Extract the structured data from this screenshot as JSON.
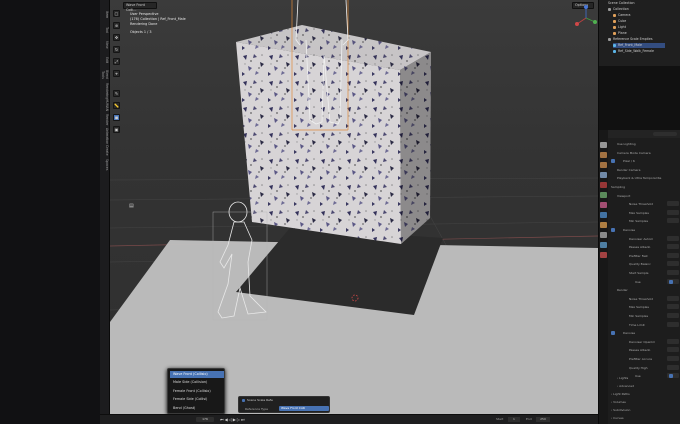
{
  "viewport": {
    "editor_label": "Wave Front Colli...",
    "overlay": {
      "line1": "User Perspective",
      "line2": "(176) Collection | Ref_Front_Male",
      "line3": "Rendering Done",
      "line4": "Objects   1 / 3"
    },
    "options_label": "Options"
  },
  "left_tabs": [
    "Item",
    "Tool",
    "View",
    "Edit",
    "Blend Tools",
    "Rendering",
    "HUMAN",
    "Render",
    "Animation",
    "Create",
    "Spaces"
  ],
  "tools": [
    "select-icon",
    "cursor-icon",
    "move-icon",
    "rotate-icon",
    "scale-icon",
    "transform-icon",
    "annotate-icon",
    "measure-icon",
    "add-cube-icon",
    "camera-icon"
  ],
  "outliner": {
    "title": "Scene Collection",
    "items": [
      {
        "label": "Collection",
        "color": "#9a9a9a",
        "indent": 1
      },
      {
        "label": "Camera",
        "color": "#e0a05a",
        "indent": 2
      },
      {
        "label": "Cube",
        "color": "#e0a05a",
        "indent": 2
      },
      {
        "label": "Light",
        "color": "#e0a05a",
        "indent": 2
      },
      {
        "label": "Plane",
        "color": "#e0a05a",
        "indent": 2
      },
      {
        "label": "Reference Scale Empties",
        "color": "#9a9a9a",
        "indent": 1
      },
      {
        "label": "Ref_Front_Male",
        "color": "#5bb5e8",
        "indent": 2,
        "selected": true
      },
      {
        "label": "Ref_Side_Walk_Female",
        "color": "#5bb5e8",
        "indent": 2
      }
    ]
  },
  "properties": {
    "rows": [
      {
        "label": "Use Lighting",
        "indent": 1
      },
      {
        "label": "Camera Mode   Camera",
        "indent": 1
      },
      {
        "label": "Pixel / 6",
        "indent": 2
      },
      {
        "label": "Render Camera",
        "indent": 1
      },
      {
        "label": "Playback & Ultra Temporal Re",
        "indent": 1
      },
      {
        "label": "Sampling",
        "indent": 0
      },
      {
        "label": "Viewport",
        "indent": 1
      },
      {
        "label": "Noise Threshold",
        "indent": 3
      },
      {
        "label": "Max Samples",
        "indent": 3
      },
      {
        "label": "Min Samples",
        "indent": 3
      },
      {
        "label": "Denoise",
        "indent": 2
      },
      {
        "label": "Denoiser   Autom",
        "indent": 3
      },
      {
        "label": "Passes   Albedo",
        "indent": 3
      },
      {
        "label": "Prefilter   Fast",
        "indent": 3
      },
      {
        "label": "Quality   Balanc",
        "indent": 3
      },
      {
        "label": "Start Sample",
        "indent": 3
      },
      {
        "label": "Use",
        "indent": 4
      },
      {
        "label": "Render",
        "indent": 1
      },
      {
        "label": "Noise Threshold",
        "indent": 3
      },
      {
        "label": "Max Samples",
        "indent": 3
      },
      {
        "label": "Min Samples",
        "indent": 3
      },
      {
        "label": "Time Limit",
        "indent": 3
      },
      {
        "label": "Denoise",
        "indent": 2
      },
      {
        "label": "Denoiser   OpenIm",
        "indent": 3
      },
      {
        "label": "Passes   Albedo",
        "indent": 3
      },
      {
        "label": "Prefilter   Accura",
        "indent": 3
      },
      {
        "label": "Quality   High",
        "indent": 3
      },
      {
        "label": "Use",
        "indent": 4
      }
    ],
    "bottom_sections": [
      "Lights",
      "Advanced",
      "Light Paths",
      "Volumes",
      "Subdivision",
      "Curves"
    ]
  },
  "redo_panel": {
    "checkbox_label": "Scene Scale Refe",
    "field_label": "Reference Type",
    "field_value": "Wave Front Colli"
  },
  "dropdown": {
    "options": [
      "Wave Front (Collisio)",
      "Male Side (Collision)",
      "Female Front (Collisio)",
      "Female Side (Collisi)",
      "Bend (Ghost)"
    ],
    "selected_index": 0
  },
  "timeline": {
    "current_frame": "176",
    "start_label": "Start",
    "start": "1",
    "end_label": "End",
    "end": "250"
  },
  "colors": {
    "accent": "#4772b3",
    "viewport_bg": "#383838"
  }
}
